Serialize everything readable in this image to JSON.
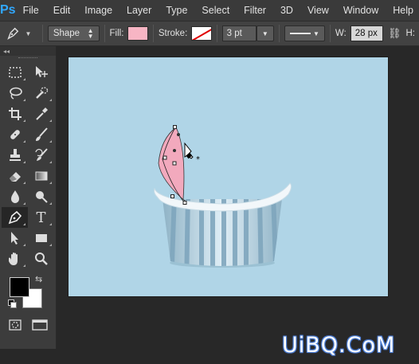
{
  "app": {
    "logo": "Ps"
  },
  "menu": [
    "File",
    "Edit",
    "Image",
    "Layer",
    "Type",
    "Select",
    "Filter",
    "3D",
    "View",
    "Window",
    "Help"
  ],
  "options": {
    "mode": "Shape",
    "fill_label": "Fill:",
    "fill_color": "#f7b5c4",
    "stroke_label": "Stroke:",
    "stroke_width": "3 pt",
    "width_label": "W:",
    "width_value": "28 px",
    "height_label": "H:"
  },
  "toolbar": {
    "collapse_glyph": "◂◂",
    "tools": [
      "rectangular-marquee-icon",
      "move-icon",
      "lasso-icon",
      "quick-selection-icon",
      "crop-icon",
      "eyedropper-icon",
      "healing-brush-icon",
      "brush-icon",
      "clone-stamp-icon",
      "history-brush-icon",
      "eraser-icon",
      "gradient-icon",
      "blur-icon",
      "dodge-icon",
      "pen-icon",
      "type-icon",
      "path-selection-icon",
      "rectangle-shape-icon",
      "hand-icon",
      "zoom-icon"
    ],
    "active_tool": "pen-icon",
    "type_glyph": "T",
    "foreground_color": "#000000",
    "background_color": "#ffffff"
  },
  "canvas": {
    "background": "#b0d5e7"
  },
  "watermark": "UiBQ.CoM"
}
